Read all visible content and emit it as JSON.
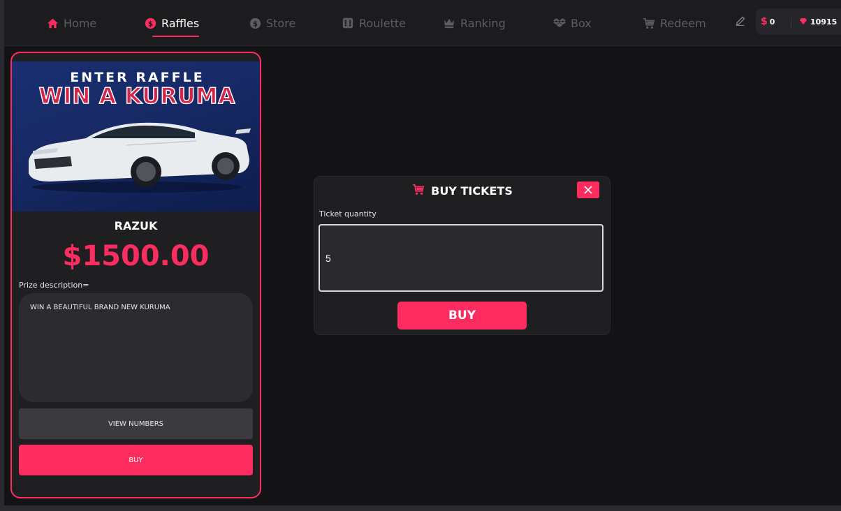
{
  "nav": {
    "items": [
      {
        "label": "Home",
        "icon": "home-icon",
        "active": false
      },
      {
        "label": "Raffles",
        "icon": "raffle-coin-icon",
        "active": true
      },
      {
        "label": "Store",
        "icon": "store-coin-icon",
        "active": false
      },
      {
        "label": "Roulette",
        "icon": "dice-icon",
        "active": false
      },
      {
        "label": "Ranking",
        "icon": "crown-icon",
        "active": false
      },
      {
        "label": "Box",
        "icon": "box-icon",
        "active": false
      },
      {
        "label": "Redeem",
        "icon": "cart-icon",
        "active": false
      }
    ]
  },
  "wallet": {
    "currency_symbol": "$",
    "cash": "0",
    "gems": "10915"
  },
  "raffle": {
    "banner_line1": "ENTER RAFFLE",
    "banner_line2": "WIN A KURUMA",
    "title": "RAZUK",
    "price": "$1500.00",
    "description_label": "Prize description=",
    "description": "WIN A BEAUTIFUL BRAND NEW KURUMA",
    "view_numbers_label": "VIEW NUMBERS",
    "buy_label": "BUY"
  },
  "modal": {
    "title": "BUY TICKETS",
    "quantity_label": "Ticket quantity",
    "quantity_value": "5",
    "buy_label": "BUY"
  },
  "colors": {
    "accent": "#ff2d5f",
    "background": "#131315",
    "panel": "#1f1f22"
  }
}
